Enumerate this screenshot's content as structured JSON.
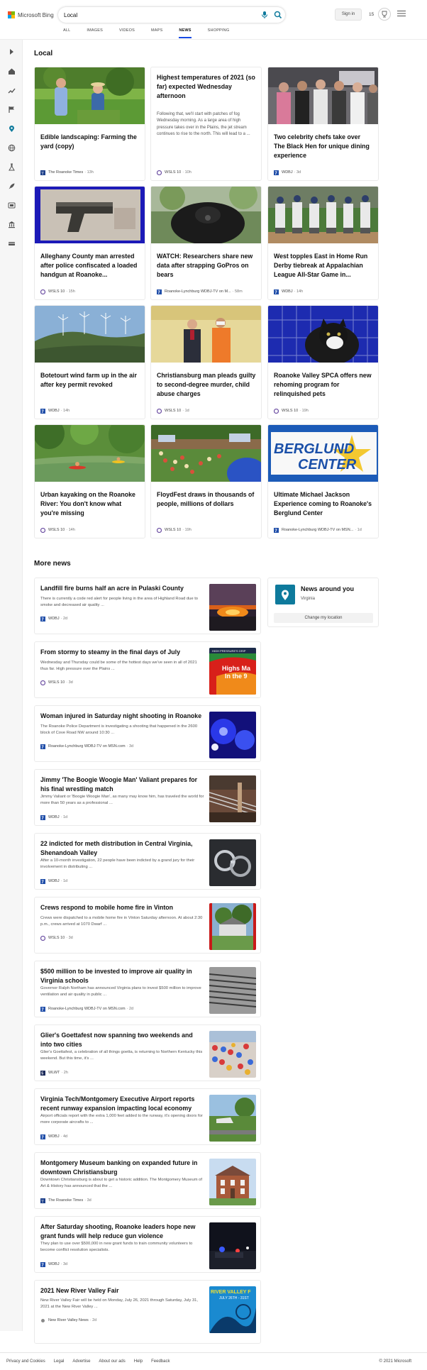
{
  "header": {
    "brand": "Microsoft Bing",
    "search_value": "Local",
    "signin_label": "Sign in",
    "rewards_count": "15"
  },
  "scopes": [
    {
      "label": "ALL",
      "active": false
    },
    {
      "label": "IMAGES",
      "active": false
    },
    {
      "label": "VIDEOS",
      "active": false
    },
    {
      "label": "MAPS",
      "active": false
    },
    {
      "label": "NEWS",
      "active": true
    },
    {
      "label": "SHOPPING",
      "active": false
    }
  ],
  "sidebar_icons": [
    "expand-icon",
    "home-icon",
    "trending-icon",
    "flag-icon",
    "location-icon",
    "globe-icon",
    "science-icon",
    "rocket-icon",
    "entertainment-icon",
    "politics-icon",
    "money-icon"
  ],
  "local": {
    "title": "Local",
    "cards": [
      {
        "title": "Edible landscaping: Farming the yard (copy)",
        "snippet": "",
        "source": "The Roanoke Times",
        "time": "13h",
        "badge": "roanoke-times-logo-icon"
      },
      {
        "title": "Highest temperatures of 2021 (so far) expected Wednesday afternoon",
        "snippet": "Following that, we'll start with patches of fog Wednesday morning. As a large area of high pressure takes over in the Plains, the jet stream continues to rise to the north. This will lead to a ...",
        "source": "WSLS 10",
        "time": "10h",
        "badge": "wsls-logo-icon"
      },
      {
        "title": "Two celebrity chefs take over The Black Hen for unique dining experience",
        "snippet": "",
        "source": "WDBJ",
        "time": "3d",
        "badge": "wdbj-logo-icon"
      },
      {
        "title": "Alleghany County man arrested after police confiscated a loaded handgun at Roanoke...",
        "snippet": "",
        "source": "WSLS 10",
        "time": "15h",
        "badge": "wsls-logo-icon"
      },
      {
        "title": "WATCH: Researchers share new data after strapping GoPros on bears",
        "snippet": "",
        "source": "Roanoke-Lynchburg WDBJ-TV on M...",
        "time": "58m",
        "badge": "wdbj-logo-icon"
      },
      {
        "title": "West topples East in Home Run Derby tiebreak at Appalachian League All-Star Game in...",
        "snippet": "",
        "source": "WDBJ",
        "time": "14h",
        "badge": "wdbj-logo-icon"
      },
      {
        "title": "Botetourt wind farm up in the air after key permit revoked",
        "snippet": "",
        "source": "WDBJ",
        "time": "14h",
        "badge": "wdbj-logo-icon"
      },
      {
        "title": "Christiansburg man pleads guilty to second-degree murder, child abuse charges",
        "snippet": "",
        "source": "WSLS 10",
        "time": "1d",
        "badge": "wsls-logo-icon"
      },
      {
        "title": "Roanoke Valley SPCA offers new rehoming program for relinquished pets",
        "snippet": "",
        "source": "WSLS 10",
        "time": "19h",
        "badge": "wsls-logo-icon"
      },
      {
        "title": "Urban kayaking on the Roanoke River: You don't know what you're missing",
        "snippet": "",
        "source": "WSLS 10",
        "time": "14h",
        "badge": "wsls-logo-icon"
      },
      {
        "title": "FloydFest draws in thousands of people, millions of dollars",
        "snippet": "",
        "source": "WSLS 10",
        "time": "19h",
        "badge": "wsls-logo-icon"
      },
      {
        "title": "Ultimate Michael Jackson Experience coming to Roanoke's Berglund Center",
        "snippet": "",
        "source": "Roanoke-Lynchburg WDBJ-TV on MSN...",
        "time": "1d",
        "badge": "wdbj-logo-icon"
      }
    ],
    "image_text": {
      "berglund_1": "BERGLUND",
      "berglund_2": "CENTER"
    }
  },
  "more_news": {
    "title": "More news",
    "items": [
      {
        "title": "Landfill fire burns half an acre in Pulaski County",
        "snippet": "There is currently a code red alert for people living in the area of Highland Road due to smoke and decreased air quality ...",
        "source": "WDBJ",
        "time": "2d"
      },
      {
        "title": "From stormy to steamy in the final days of July",
        "snippet": "Wednesday and Thursday could be some of the hottest days we've seen in all of 2021 thus far. High pressure over the Plains ...",
        "source": "WSLS 10",
        "time": "3d"
      },
      {
        "title": "Woman injured in Saturday night shooting in Roanoke",
        "snippet": "The Roanoke Police Department is investigating a shooting that happened in the 2600 block of Cove Road NW around 10:30 ...",
        "source": "Roanoke-Lynchburg WDBJ-TV on MSN.com",
        "time": "3d"
      },
      {
        "title": "Jimmy 'The Boogie Woogie Man' Valiant prepares for his final wrestling match",
        "snippet": "Jimmy Valiant or 'Boogie Woogie Man', as many may know him, has traveled the world for more than 50 years as a professional ...",
        "source": "WDBJ",
        "time": "1d"
      },
      {
        "title": "22 indicted for meth distribution in Central Virginia, Shenandoah Valley",
        "snippet": "After a 10-month investigation, 22 people have been indicted by a grand jury for their involvement in distributing ...",
        "source": "WDBJ",
        "time": "1d"
      },
      {
        "title": "Crews respond to mobile home fire in Vinton",
        "snippet": "Crews were dispatched to a mobile home fire in Vinton Saturday afternoon. At about 2:30 p.m., crews arrived at 1070 Dwarf ...",
        "source": "WSLS 10",
        "time": "3d"
      },
      {
        "title": "$500 million to be invested to improve air quality in Virginia schools",
        "snippet": "Governor Ralph Northam has announced Virginia plans to invest $500 million to improve ventilation and air quality in public ...",
        "source": "Roanoke-Lynchburg WDBJ-TV on MSN.com",
        "time": "2d"
      },
      {
        "title": "Glier's Goettafest now spanning two weekends and into two cities",
        "snippet": "Glier's Goettafest, a celebration of all things goetta, is returning to Northern Kentucky this weekend. But this time, it's ...",
        "source": "WLWT",
        "time": "2h"
      },
      {
        "title": "Virginia Tech/Montgomery Executive Airport reports recent runway expansion impacting local economy",
        "snippet": "Airport officials report with the extra 1,000 feet added to the runway, it's opening doors for more corporate aircrafts to ...",
        "source": "WDBJ",
        "time": "4d"
      },
      {
        "title": "Montgomery Museum banking on expanded future in downtown Christiansburg",
        "snippet": "Downtown Christiansburg is about to get a historic addition. The Montgomery Museum of Art & History has announced that the ...",
        "source": "The Roanoke Times",
        "time": "3d"
      },
      {
        "title": "After Saturday shooting, Roanoke leaders hope new grant funds will help reduce gun violence",
        "snippet": "They plan to use over $500,000 in new grant funds to train community volunteers to become conflict resolution specialists.",
        "source": "WDBJ",
        "time": "3d"
      },
      {
        "title": "2021 New River Valley Fair",
        "snippet": "New River Valley Fair will be held on Monday, July 26, 2021 through Saturday, July 31, 2021 at the New River Valley ...",
        "source": "New River Valley News",
        "time": "2d"
      }
    ],
    "image_text": {
      "weather_badge": "HIGH PRESSURE'S GRIP",
      "weather_1": "Highs Ma",
      "weather_2": "In the 9",
      "fair_1": "RIVER VALLEY F",
      "fair_2": "JULY 26TH - 31ST"
    }
  },
  "news_around_you": {
    "title": "News around you",
    "location": "Virginia",
    "change_label": "Change my location"
  },
  "footer": {
    "links": [
      "Privacy and Cookies",
      "Legal",
      "Advertise",
      "About our ads",
      "Help",
      "Feedback"
    ],
    "copyright": "© 2021 Microsoft"
  },
  "colors": {
    "accent": "#174ae4",
    "bing_teal": "#0e7a9c",
    "ms_red": "#f25022",
    "ms_green": "#7fba00",
    "ms_blue": "#00a4ef",
    "ms_yellow": "#ffb900"
  }
}
